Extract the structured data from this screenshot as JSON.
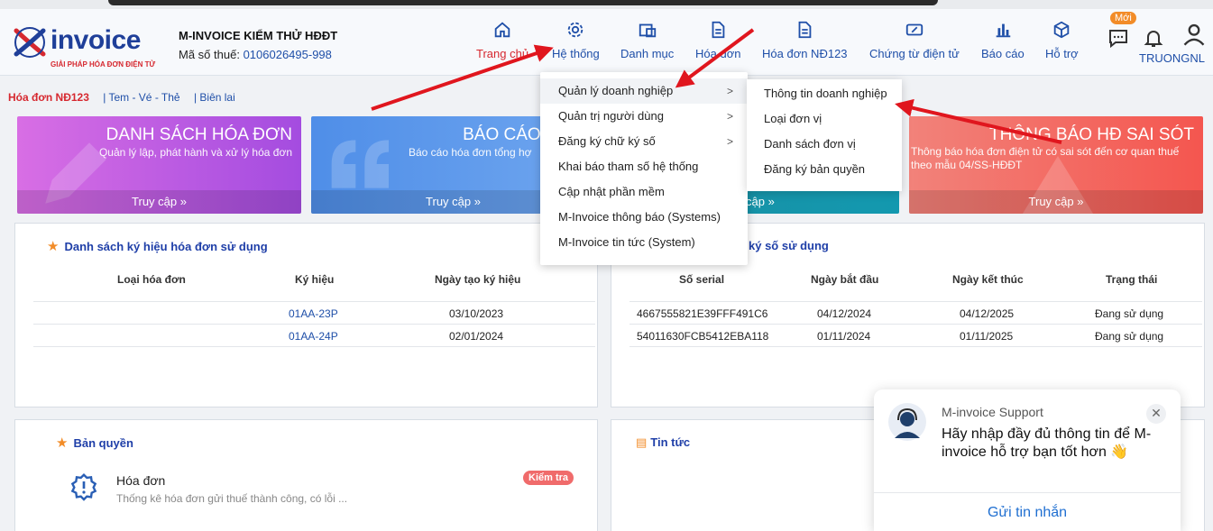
{
  "company": {
    "name": "M-INVOICE KIỂM THỬ HĐĐT",
    "tax_label": "Mã số thuế:",
    "tax_value": "0106026495-998"
  },
  "logo": {
    "word": "invoice",
    "tagline": "GIẢI PHÁP HÓA ĐƠN ĐIỆN TỬ"
  },
  "nav": {
    "items": [
      {
        "label": "Trang chủ",
        "icon": "home-icon"
      },
      {
        "label": "Hệ thống",
        "icon": "gear-icon"
      },
      {
        "label": "Danh mục",
        "icon": "folder-icon"
      },
      {
        "label": "Hóa đơn",
        "icon": "document-icon"
      },
      {
        "label": "Hóa đơn NĐ123",
        "icon": "document-icon"
      },
      {
        "label": "Chứng từ điện tử",
        "icon": "ticket-icon"
      },
      {
        "label": "Báo cáo",
        "icon": "bar-chart-icon"
      },
      {
        "label": "Hỗ trợ",
        "icon": "box-icon"
      }
    ],
    "new_badge": "Mới",
    "user": "TRUONGNL"
  },
  "subnav": [
    "Hóa đơn NĐ123",
    "| Tem - Vé - Thẻ",
    "| Biên lai"
  ],
  "banners": [
    {
      "title": "DANH SÁCH HÓA ĐƠN",
      "desc": "Quản lý lập, phát hành và xử lý hóa đơn",
      "access": "Truy cập »"
    },
    {
      "title": "BÁO CÁO, THỐ",
      "desc": "Báo cáo hóa đơn tổng hợ",
      "access": "Truy cập »"
    },
    {
      "access": "cập »"
    },
    {
      "title": "THÔNG BÁO HĐ SAI SÓT",
      "desc": "Thông báo hóa đơn điện tử có sai sót đến cơ quan thuế theo mẫu 04/SS-HĐĐT",
      "access": "Truy cập »"
    }
  ],
  "symbols_card": {
    "title": "Danh sách ký hiệu hóa đơn sử dụng",
    "headers": [
      "Loại hóa đơn",
      "Ký hiệu",
      "Ngày tạo ký hiệu"
    ],
    "rows": [
      {
        "type": "",
        "symbol": "01AA-23P",
        "date": "03/10/2023"
      },
      {
        "type": "",
        "symbol": "01AA-24P",
        "date": "02/01/2024"
      }
    ]
  },
  "cert_card": {
    "title": "ký số sử dụng",
    "headers": [
      "Số serial",
      "Ngày bắt đầu",
      "Ngày kết thúc",
      "Trạng thái"
    ],
    "rows": [
      {
        "serial": "4667555821E39FFF491C6",
        "start": "04/12/2024",
        "end": "04/12/2025",
        "status": "Đang sử dụng"
      },
      {
        "serial": "54011630FCB5412EBA118",
        "start": "01/11/2024",
        "end": "01/11/2025",
        "status": "Đang sử dụng"
      }
    ]
  },
  "license_card": {
    "title": "Bản quyền",
    "item_title": "Hóa đơn",
    "item_desc": "Thống kê hóa đơn gửi thuế thành công, có lỗi ...",
    "badge": "Kiểm tra"
  },
  "news_card": {
    "title": "Tin tức"
  },
  "menu": {
    "items": [
      {
        "label": "Quản lý doanh nghiệp",
        "has_sub": true
      },
      {
        "label": "Quản trị người dùng",
        "has_sub": true
      },
      {
        "label": "Đăng ký chữ ký số",
        "has_sub": true
      },
      {
        "label": "Khai báo tham số hệ thống",
        "has_sub": false
      },
      {
        "label": "Cập nhật phần mềm",
        "has_sub": false
      },
      {
        "label": "M-Invoice thông báo (Systems)",
        "has_sub": false
      },
      {
        "label": "M-Invoice tin tức (System)",
        "has_sub": false
      }
    ],
    "submenu": [
      "Thông tin doanh nghiệp",
      "Loại đơn vị",
      "Danh sách đơn vị",
      "Đăng ký bản quyền"
    ]
  },
  "chat": {
    "from": "M-invoice Support",
    "message": "Hãy nhập đầy đủ thông tin để M-invoice hỗ trợ bạn tốt hơn 👋",
    "send": "Gửi tin nhắn"
  },
  "colors": {
    "brand": "#1f3f99",
    "accent_red": "#d6282f",
    "link": "#1f4fa8",
    "arrow": "#e0161e"
  }
}
